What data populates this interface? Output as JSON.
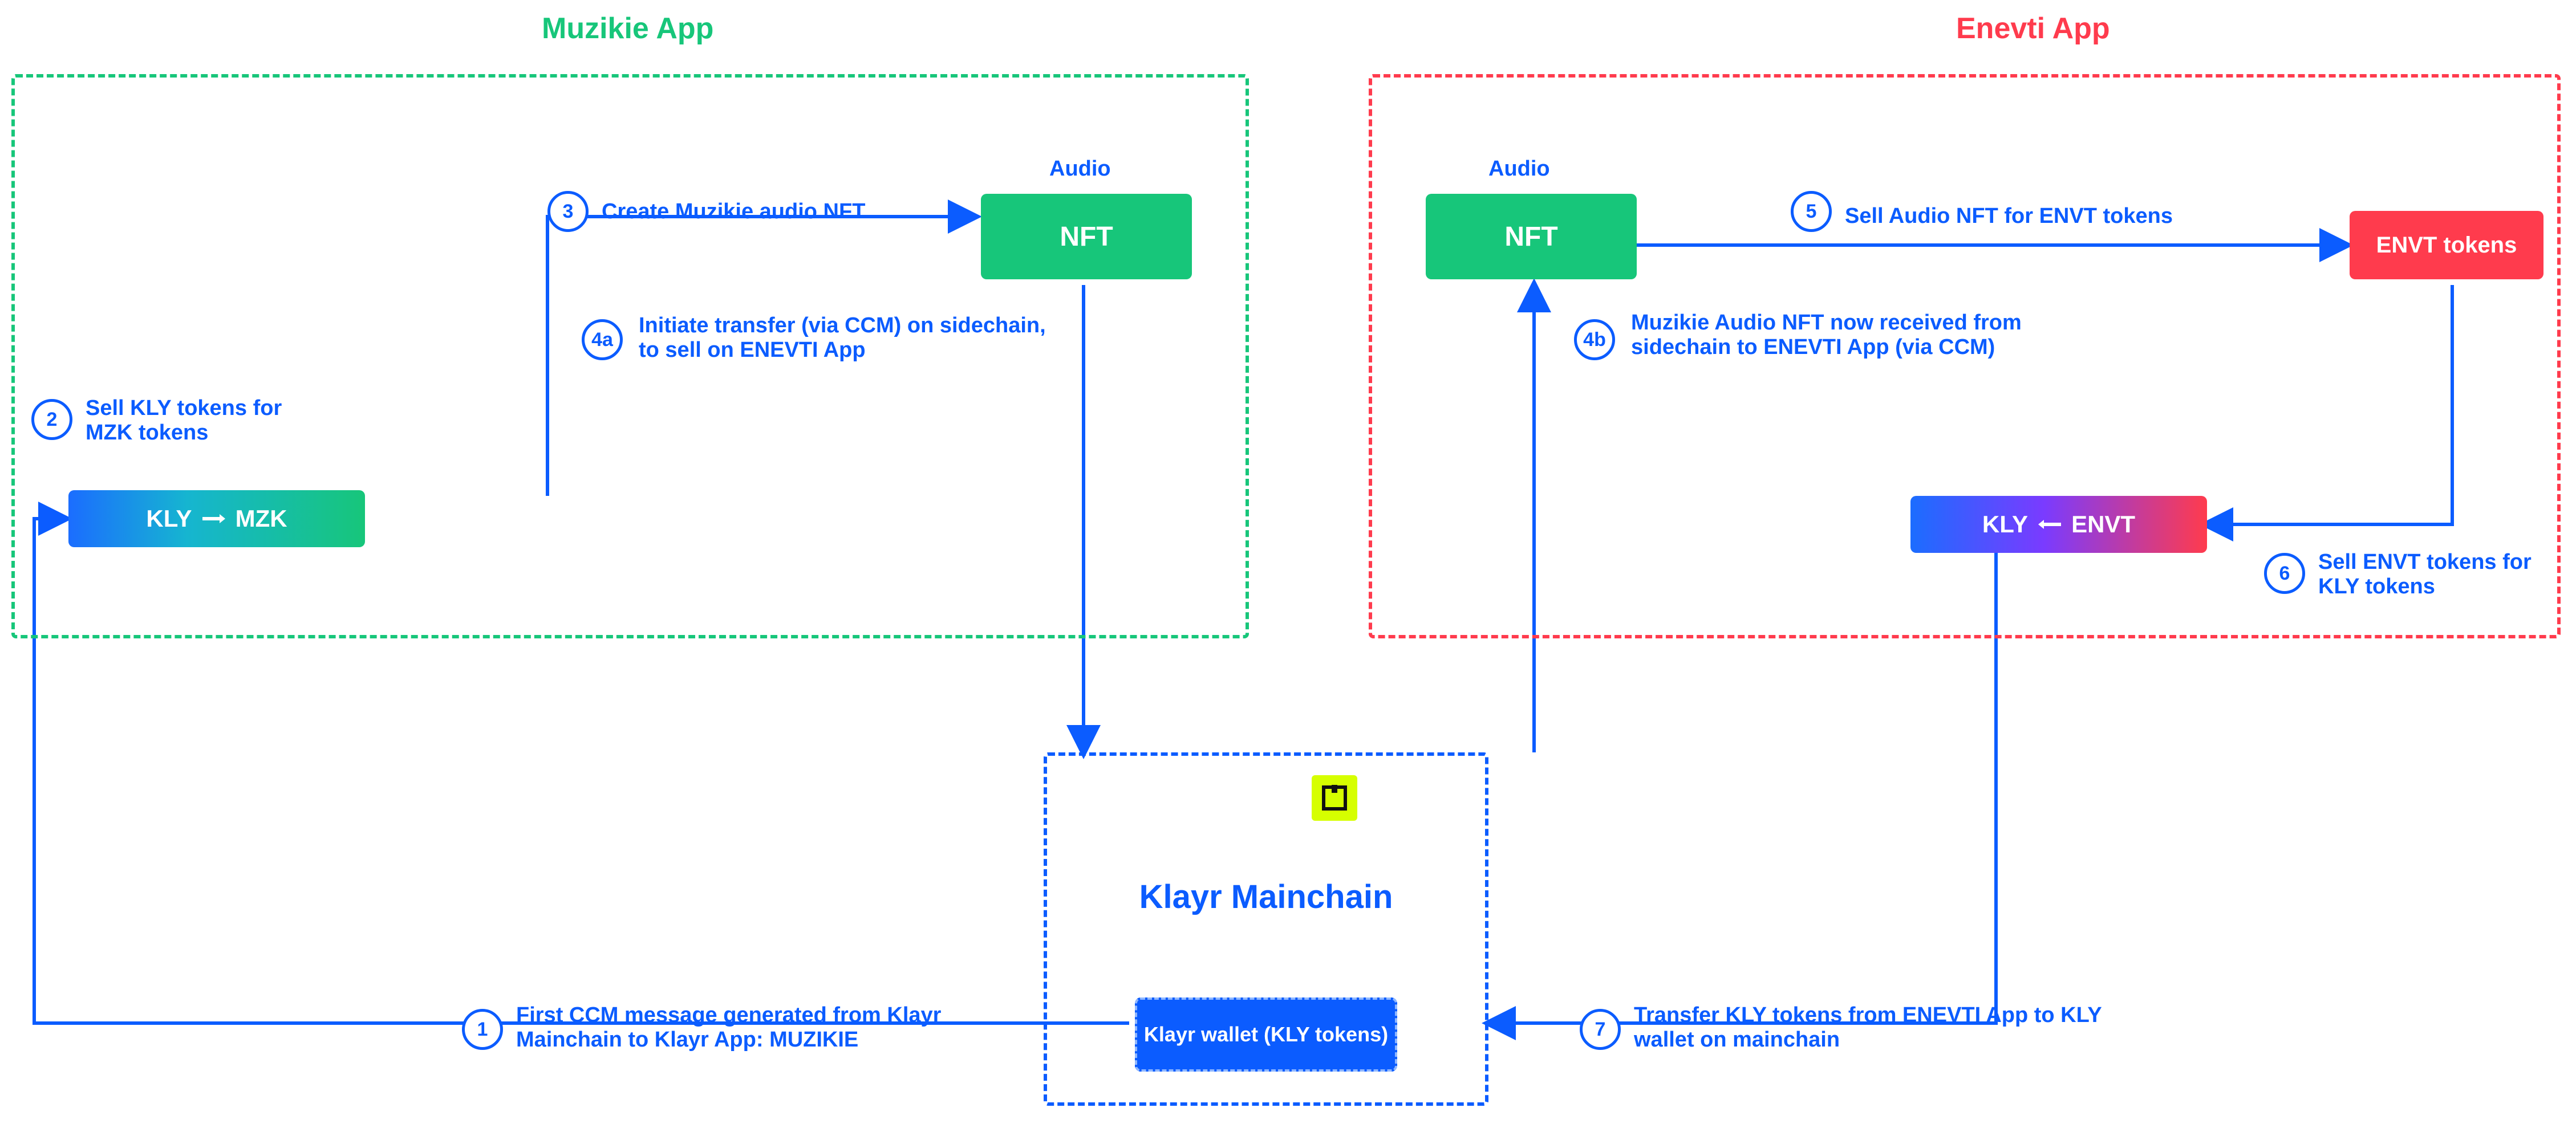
{
  "apps": {
    "muzikie": {
      "title": "Muzikie App"
    },
    "enevti": {
      "title": "Enevti App"
    },
    "mainchain": {
      "title": "Klayr Mainchain",
      "wallet": "Klayr wallet (KLY tokens)"
    }
  },
  "nodes": {
    "nft_audio_label": "Audio",
    "nft_label": "NFT",
    "envt_tokens": "ENVT tokens",
    "swap_muzikie": {
      "from": "KLY",
      "to": "MZK"
    },
    "swap_enevti": {
      "from": "KLY",
      "to": "ENVT"
    }
  },
  "steps": {
    "s1": {
      "num": "1",
      "text": "First CCM message generated  from Klayr Mainchain to Klayr App: MUZIKIE"
    },
    "s2": {
      "num": "2",
      "text": "Sell KLY tokens for MZK tokens"
    },
    "s3": {
      "num": "3",
      "text": "Create Muzikie audio NFT"
    },
    "s4a": {
      "num": "4a",
      "text": "Initiate transfer (via CCM) on sidechain,  to sell on ENEVTI App"
    },
    "s4b": {
      "num": "4b",
      "text": "Muzikie Audio NFT now  received from sidechain to ENEVTI App (via CCM)"
    },
    "s5": {
      "num": "5",
      "text": "Sell Audio NFT for ENVT tokens"
    },
    "s6": {
      "num": "6",
      "text": "Sell ENVT tokens for KLY tokens"
    },
    "s7": {
      "num": "7",
      "text": "Transfer KLY tokens from ENEVTI App to KLY wallet on mainchain"
    }
  },
  "colors": {
    "blue": "#0b5cff",
    "green": "#17c67a",
    "red": "#ff3b4d"
  }
}
